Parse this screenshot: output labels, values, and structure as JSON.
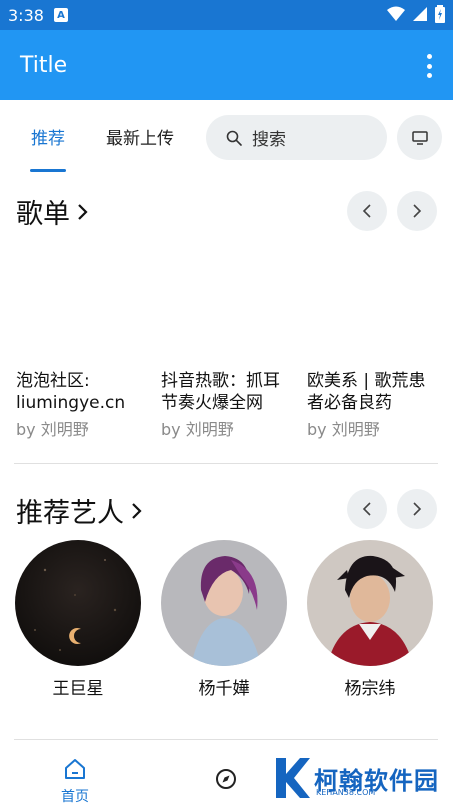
{
  "status": {
    "time": "3:38",
    "a_label": "A"
  },
  "appbar": {
    "title": "Title"
  },
  "tabs": [
    {
      "label": "推荐"
    },
    {
      "label": "最新上传"
    }
  ],
  "search": {
    "label": "搜索"
  },
  "sections": {
    "playlists": {
      "title": "歌单"
    },
    "artists": {
      "title": "推荐艺人"
    }
  },
  "playlists": [
    {
      "title": "泡泡社区: liumingye.cn",
      "by": "by 刘明野"
    },
    {
      "title": "抖音热歌：抓耳节奏火爆全网",
      "by": "by 刘明野"
    },
    {
      "title": "欧美系 | 歌荒患者必备良药",
      "by": "by 刘明野"
    }
  ],
  "artists": [
    {
      "name": "王巨星"
    },
    {
      "name": "杨千嬅"
    },
    {
      "name": "杨宗纬"
    }
  ],
  "bottom_nav": {
    "home_label": "首页"
  },
  "watermark": {
    "text": "柯翰软件园",
    "sub": "KEHAN38.COM"
  },
  "colors": {
    "primary": "#2196f3",
    "status": "#1976d2",
    "accent": "#1976d2"
  }
}
